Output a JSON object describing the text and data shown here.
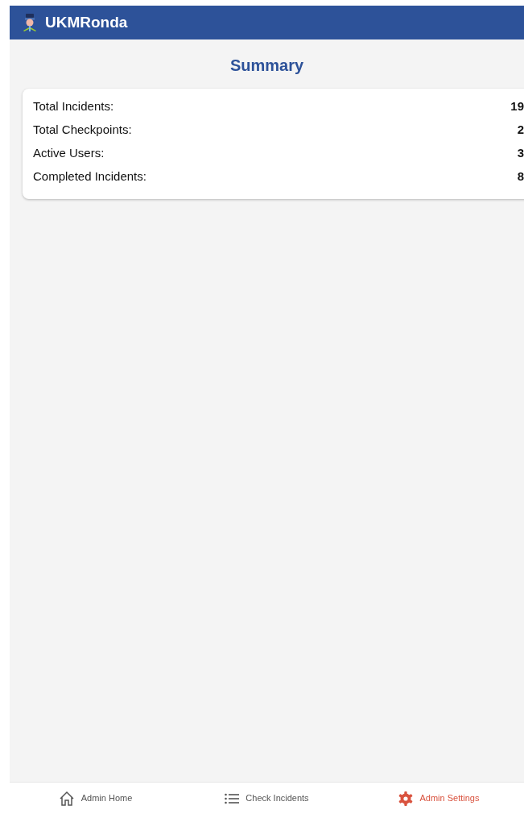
{
  "app_bar": {
    "title": "UKMRonda"
  },
  "summary": {
    "title": "Summary",
    "rows": [
      {
        "label": "Total Incidents:",
        "value": "19"
      },
      {
        "label": "Total Checkpoints:",
        "value": "2"
      },
      {
        "label": "Active Users:",
        "value": "3"
      },
      {
        "label": "Completed Incidents:",
        "value": "8"
      }
    ]
  },
  "bottom_nav": [
    {
      "label": "Admin Home",
      "kind": "home",
      "selected": false
    },
    {
      "label": "Check Incidents",
      "kind": "list",
      "selected": false
    },
    {
      "label": "Admin Settings",
      "kind": "settings",
      "selected": true
    }
  ]
}
